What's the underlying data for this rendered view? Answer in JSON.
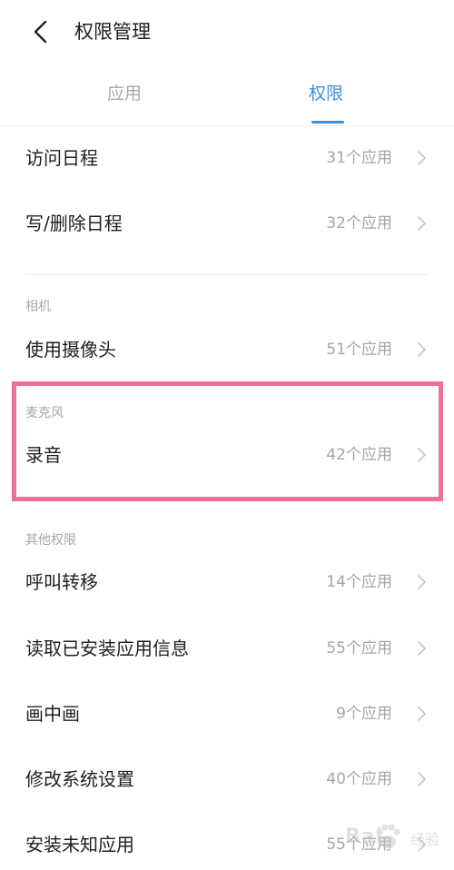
{
  "header": {
    "title": "权限管理"
  },
  "tabs": {
    "apps_label": "应用",
    "permissions_label": "权限",
    "active": "permissions"
  },
  "colors": {
    "accent": "#3d8fd8",
    "highlight_box": "#ee6f98",
    "secondary_text": "#a6a6a6"
  },
  "rows": {
    "access_calendar": {
      "label": "访问日程",
      "count": "31个应用"
    },
    "write_delete_calendar": {
      "label": "写/删除日程",
      "count": "32个应用"
    },
    "use_camera": {
      "label": "使用摄像头",
      "count": "51个应用"
    },
    "record_audio": {
      "label": "录音",
      "count": "42个应用"
    },
    "call_forwarding": {
      "label": "呼叫转移",
      "count": "14个应用"
    },
    "read_installed_apps": {
      "label": "读取已安装应用信息",
      "count": "55个应用"
    },
    "picture_in_picture": {
      "label": "画中画",
      "count": "9个应用"
    },
    "modify_system_settings": {
      "label": "修改系统设置",
      "count": "40个应用"
    },
    "install_unknown_apps": {
      "label": "安装未知应用",
      "count": "55个应用"
    }
  },
  "sections": {
    "camera": "相机",
    "microphone": "麦克风",
    "other": "其他权限"
  },
  "icons": {
    "back": "chevron-left-icon",
    "row_arrow": "chevron-right-icon"
  },
  "watermark": {
    "text": "Bai",
    "suffix": "经验"
  }
}
